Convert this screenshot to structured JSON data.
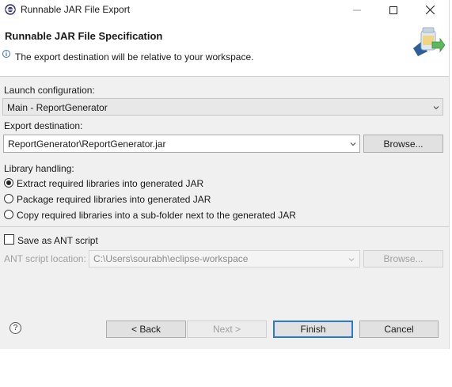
{
  "window": {
    "title": "Runnable JAR File Export",
    "minimize_icon": "minimize-icon",
    "maximize_icon": "maximize-icon",
    "close_icon": "close-icon"
  },
  "header": {
    "title": "Runnable JAR File Specification",
    "message": "The export destination will be relative to your workspace.",
    "info_icon": "info-icon"
  },
  "launch": {
    "label": "Launch configuration:",
    "value": "Main - ReportGenerator"
  },
  "destination": {
    "label": "Export destination:",
    "value": "ReportGenerator\\ReportGenerator.jar",
    "browse_label": "Browse..."
  },
  "library": {
    "label": "Library handling:",
    "options": [
      {
        "label": "Extract required libraries into generated JAR",
        "selected": true
      },
      {
        "label": "Package required libraries into generated JAR",
        "selected": false
      },
      {
        "label": "Copy required libraries into a sub-folder next to the generated JAR",
        "selected": false
      }
    ]
  },
  "ant": {
    "checkbox_label": "Save as ANT script",
    "checked": false,
    "location_label": "ANT script location:",
    "location_value": "C:\\Users\\sourabh\\eclipse-workspace",
    "browse_label": "Browse..."
  },
  "footer": {
    "help_icon": "help-icon",
    "back_label": "< Back",
    "next_label": "Next >",
    "finish_label": "Finish",
    "cancel_label": "Cancel"
  },
  "colors": {
    "dialog_bg": "#f0f0f0",
    "default_button_border": "#2a7ad4"
  }
}
